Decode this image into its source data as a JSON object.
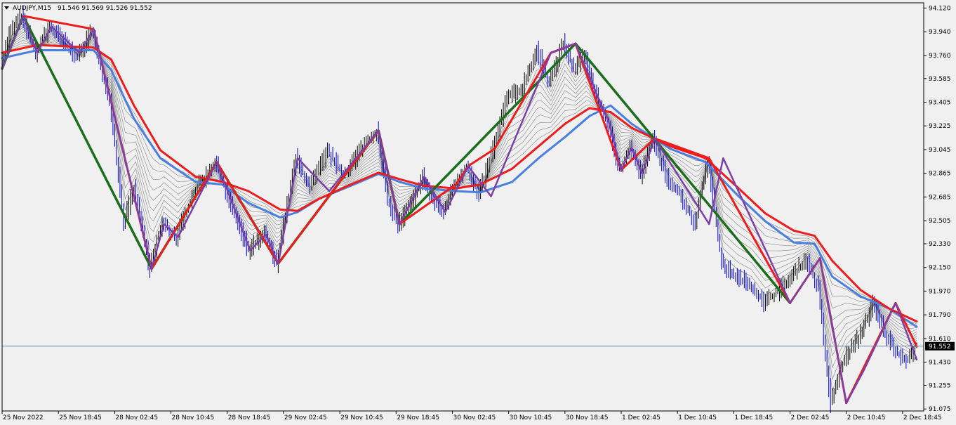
{
  "header": {
    "symbol": "AUDJPY,M15",
    "ohlc": "91.546 91.569 91.526 91.552",
    "menu_icon": "triangle-down-icon"
  },
  "colors": {
    "background": "#f0f0f0",
    "axis": "#000000",
    "price_bars": "#0000cc",
    "ma_fast": "#4a7ee0",
    "ma_slow": "#ee1c1c",
    "ribbon": "#555555",
    "zigzag_major": "#1b6e1b",
    "zigzag_minor": "#ee1c1c",
    "zigzag_micro": "#7b3fa8",
    "current_line": "#6f8aa6",
    "badge": "#000000"
  },
  "current_price": {
    "value": 91.552,
    "label": "91.552"
  },
  "chart_data": {
    "type": "line",
    "title": "AUDJPY,M15",
    "y_axis": {
      "ylim": [
        91.06,
        94.16
      ],
      "ticks": [
        "94.120",
        "93.940",
        "93.760",
        "93.585",
        "93.405",
        "93.225",
        "93.045",
        "92.865",
        "92.685",
        "92.505",
        "92.330",
        "92.150",
        "91.970",
        "91.790",
        "91.610",
        "91.430",
        "91.255",
        "91.075"
      ]
    },
    "x_axis": {
      "bar_range": [
        0,
        524
      ],
      "tick_labels": [
        "25 Nov 2022",
        "25 Nov 18:45",
        "28 Nov 02:45",
        "28 Nov 10:45",
        "28 Nov 18:45",
        "29 Nov 02:45",
        "29 Nov 10:45",
        "29 Nov 18:45",
        "30 Nov 02:45",
        "30 Nov 10:45",
        "30 Nov 18:45",
        "1 Dec 02:45",
        "1 Dec 10:45",
        "1 Dec 18:45",
        "2 Dec 02:45",
        "2 Dec 10:45",
        "2 Dec 18:45"
      ],
      "tick_bars": [
        0,
        32,
        64,
        96,
        128,
        160,
        192,
        224,
        256,
        288,
        320,
        352,
        384,
        416,
        448,
        480,
        512
      ]
    },
    "price_path": [
      [
        0,
        93.66
      ],
      [
        5,
        93.92
      ],
      [
        12,
        94.06
      ],
      [
        20,
        93.78
      ],
      [
        28,
        93.98
      ],
      [
        36,
        93.86
      ],
      [
        44,
        93.74
      ],
      [
        52,
        93.96
      ],
      [
        56,
        93.72
      ],
      [
        62,
        93.45
      ],
      [
        70,
        92.5
      ],
      [
        76,
        92.75
      ],
      [
        85,
        92.14
      ],
      [
        92,
        92.48
      ],
      [
        100,
        92.38
      ],
      [
        110,
        92.72
      ],
      [
        122,
        92.95
      ],
      [
        132,
        92.6
      ],
      [
        141,
        92.28
      ],
      [
        150,
        92.4
      ],
      [
        157,
        92.18
      ],
      [
        168,
        92.98
      ],
      [
        176,
        92.76
      ],
      [
        186,
        93.03
      ],
      [
        195,
        92.85
      ],
      [
        206,
        93.07
      ],
      [
        214,
        93.19
      ],
      [
        220,
        92.66
      ],
      [
        226,
        92.48
      ],
      [
        234,
        92.64
      ],
      [
        240,
        92.84
      ],
      [
        246,
        92.66
      ],
      [
        252,
        92.57
      ],
      [
        258,
        92.78
      ],
      [
        265,
        92.92
      ],
      [
        272,
        92.7
      ],
      [
        280,
        93.05
      ],
      [
        288,
        93.44
      ],
      [
        296,
        93.5
      ],
      [
        305,
        93.8
      ],
      [
        312,
        93.55
      ],
      [
        320,
        93.85
      ],
      [
        326,
        93.65
      ],
      [
        332,
        93.78
      ],
      [
        338,
        93.47
      ],
      [
        345,
        93.25
      ],
      [
        352,
        92.89
      ],
      [
        358,
        93.06
      ],
      [
        364,
        92.86
      ],
      [
        371,
        93.13
      ],
      [
        378,
        92.85
      ],
      [
        385,
        92.73
      ],
      [
        395,
        92.48
      ],
      [
        402,
        92.98
      ],
      [
        410,
        92.18
      ],
      [
        418,
        92.08
      ],
      [
        426,
        92.03
      ],
      [
        434,
        91.88
      ],
      [
        442,
        91.97
      ],
      [
        450,
        92.08
      ],
      [
        458,
        92.22
      ],
      [
        465,
        91.98
      ],
      [
        472,
        91.12
      ],
      [
        480,
        91.46
      ],
      [
        488,
        91.62
      ],
      [
        496,
        91.87
      ],
      [
        504,
        91.62
      ],
      [
        510,
        91.5
      ],
      [
        516,
        91.45
      ],
      [
        520,
        91.55
      ]
    ],
    "series": [
      {
        "key": "zigzag_major",
        "points": [
          [
            0,
            93.66
          ],
          [
            12,
            94.06
          ],
          [
            85,
            92.14
          ],
          [
            122,
            92.95
          ],
          [
            157,
            92.18
          ],
          [
            214,
            93.19
          ],
          [
            226,
            92.48
          ],
          [
            326,
            93.85
          ],
          [
            448,
            91.88
          ]
        ]
      },
      {
        "key": "zigzag_minor",
        "points": [
          [
            12,
            94.06
          ],
          [
            52,
            93.96
          ],
          [
            85,
            92.14
          ],
          [
            122,
            92.95
          ],
          [
            157,
            92.18
          ],
          [
            214,
            93.19
          ],
          [
            226,
            92.48
          ],
          [
            258,
            92.78
          ],
          [
            265,
            92.92
          ],
          [
            280,
            93.05
          ],
          [
            312,
            93.78
          ],
          [
            326,
            93.85
          ],
          [
            352,
            92.89
          ],
          [
            371,
            93.13
          ],
          [
            402,
            92.98
          ],
          [
            448,
            91.88
          ],
          [
            465,
            92.22
          ],
          [
            480,
            91.12
          ],
          [
            508,
            91.88
          ],
          [
            520,
            91.55
          ]
        ]
      },
      {
        "key": "zigzag_micro",
        "points": [
          [
            0,
            93.66
          ],
          [
            12,
            94.06
          ],
          [
            20,
            93.78
          ],
          [
            28,
            93.98
          ],
          [
            44,
            93.78
          ],
          [
            52,
            93.96
          ],
          [
            85,
            92.14
          ],
          [
            92,
            92.48
          ],
          [
            100,
            92.38
          ],
          [
            122,
            92.95
          ],
          [
            141,
            92.28
          ],
          [
            150,
            92.4
          ],
          [
            157,
            92.18
          ],
          [
            168,
            92.98
          ],
          [
            186,
            92.73
          ],
          [
            214,
            93.19
          ],
          [
            226,
            92.48
          ],
          [
            240,
            92.84
          ],
          [
            252,
            92.57
          ],
          [
            265,
            92.92
          ],
          [
            278,
            92.69
          ],
          [
            312,
            93.78
          ],
          [
            326,
            93.85
          ],
          [
            338,
            93.47
          ],
          [
            345,
            93.25
          ],
          [
            352,
            92.89
          ],
          [
            358,
            93.06
          ],
          [
            364,
            92.86
          ],
          [
            371,
            93.13
          ],
          [
            402,
            92.48
          ],
          [
            410,
            92.98
          ],
          [
            448,
            91.88
          ],
          [
            458,
            92.08
          ],
          [
            465,
            92.22
          ],
          [
            480,
            91.12
          ],
          [
            490,
            91.37
          ],
          [
            508,
            91.88
          ],
          [
            520,
            91.45
          ]
        ]
      },
      {
        "key": "ma_slow",
        "points": [
          [
            0,
            93.78
          ],
          [
            20,
            93.84
          ],
          [
            52,
            93.82
          ],
          [
            62,
            93.73
          ],
          [
            75,
            93.38
          ],
          [
            90,
            93.04
          ],
          [
            110,
            92.84
          ],
          [
            125,
            92.8
          ],
          [
            140,
            92.73
          ],
          [
            158,
            92.59
          ],
          [
            168,
            92.58
          ],
          [
            180,
            92.67
          ],
          [
            200,
            92.79
          ],
          [
            214,
            92.87
          ],
          [
            226,
            92.82
          ],
          [
            240,
            92.77
          ],
          [
            258,
            92.75
          ],
          [
            272,
            92.78
          ],
          [
            290,
            92.9
          ],
          [
            305,
            93.07
          ],
          [
            320,
            93.24
          ],
          [
            334,
            93.36
          ],
          [
            346,
            93.33
          ],
          [
            358,
            93.21
          ],
          [
            380,
            93.07
          ],
          [
            400,
            92.98
          ],
          [
            418,
            92.76
          ],
          [
            434,
            92.56
          ],
          [
            450,
            92.43
          ],
          [
            462,
            92.39
          ],
          [
            472,
            92.2
          ],
          [
            488,
            91.98
          ],
          [
            504,
            91.84
          ],
          [
            520,
            91.74
          ]
        ]
      },
      {
        "key": "ma_fast",
        "points": [
          [
            0,
            93.74
          ],
          [
            20,
            93.8
          ],
          [
            52,
            93.8
          ],
          [
            62,
            93.65
          ],
          [
            75,
            93.28
          ],
          [
            90,
            92.98
          ],
          [
            110,
            92.8
          ],
          [
            125,
            92.78
          ],
          [
            140,
            92.64
          ],
          [
            158,
            92.53
          ],
          [
            168,
            92.57
          ],
          [
            180,
            92.67
          ],
          [
            200,
            92.78
          ],
          [
            214,
            92.86
          ],
          [
            226,
            92.8
          ],
          [
            240,
            92.75
          ],
          [
            258,
            92.73
          ],
          [
            272,
            92.72
          ],
          [
            290,
            92.8
          ],
          [
            305,
            92.98
          ],
          [
            320,
            93.14
          ],
          [
            334,
            93.3
          ],
          [
            346,
            93.38
          ],
          [
            358,
            93.24
          ],
          [
            380,
            93.05
          ],
          [
            400,
            92.95
          ],
          [
            418,
            92.7
          ],
          [
            434,
            92.5
          ],
          [
            450,
            92.34
          ],
          [
            462,
            92.33
          ],
          [
            472,
            92.08
          ],
          [
            488,
            91.93
          ],
          [
            504,
            91.84
          ],
          [
            520,
            91.7
          ]
        ]
      }
    ]
  }
}
